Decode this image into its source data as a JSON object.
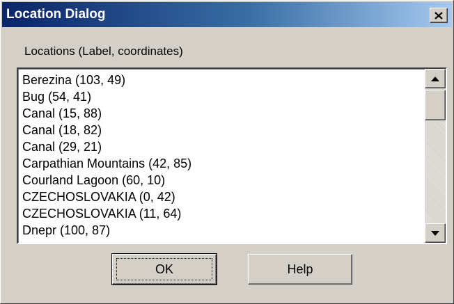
{
  "window": {
    "title": "Location Dialog",
    "close_glyph": "close-icon"
  },
  "locations": {
    "label": "Locations (Label, coordinates)",
    "items": [
      "Berezina (103, 49)",
      "Bug (54, 41)",
      "Canal (15, 88)",
      "Canal (18, 82)",
      "Canal (29, 21)",
      "Carpathian Mountains (42, 85)",
      "Courland Lagoon (60, 10)",
      "CZECHOSLOVAKIA (0, 42)",
      "CZECHOSLOVAKIA (11, 64)",
      "Dnepr (100, 87)"
    ]
  },
  "scrollbar": {
    "up_icon": "scroll-up-arrow-icon",
    "down_icon": "scroll-down-arrow-icon"
  },
  "buttons": {
    "ok_label": "OK",
    "help_label": "Help"
  },
  "colors": {
    "titlebar_start": "#0a246a",
    "titlebar_end": "#a6caf0",
    "face": "#d4d0c8"
  }
}
